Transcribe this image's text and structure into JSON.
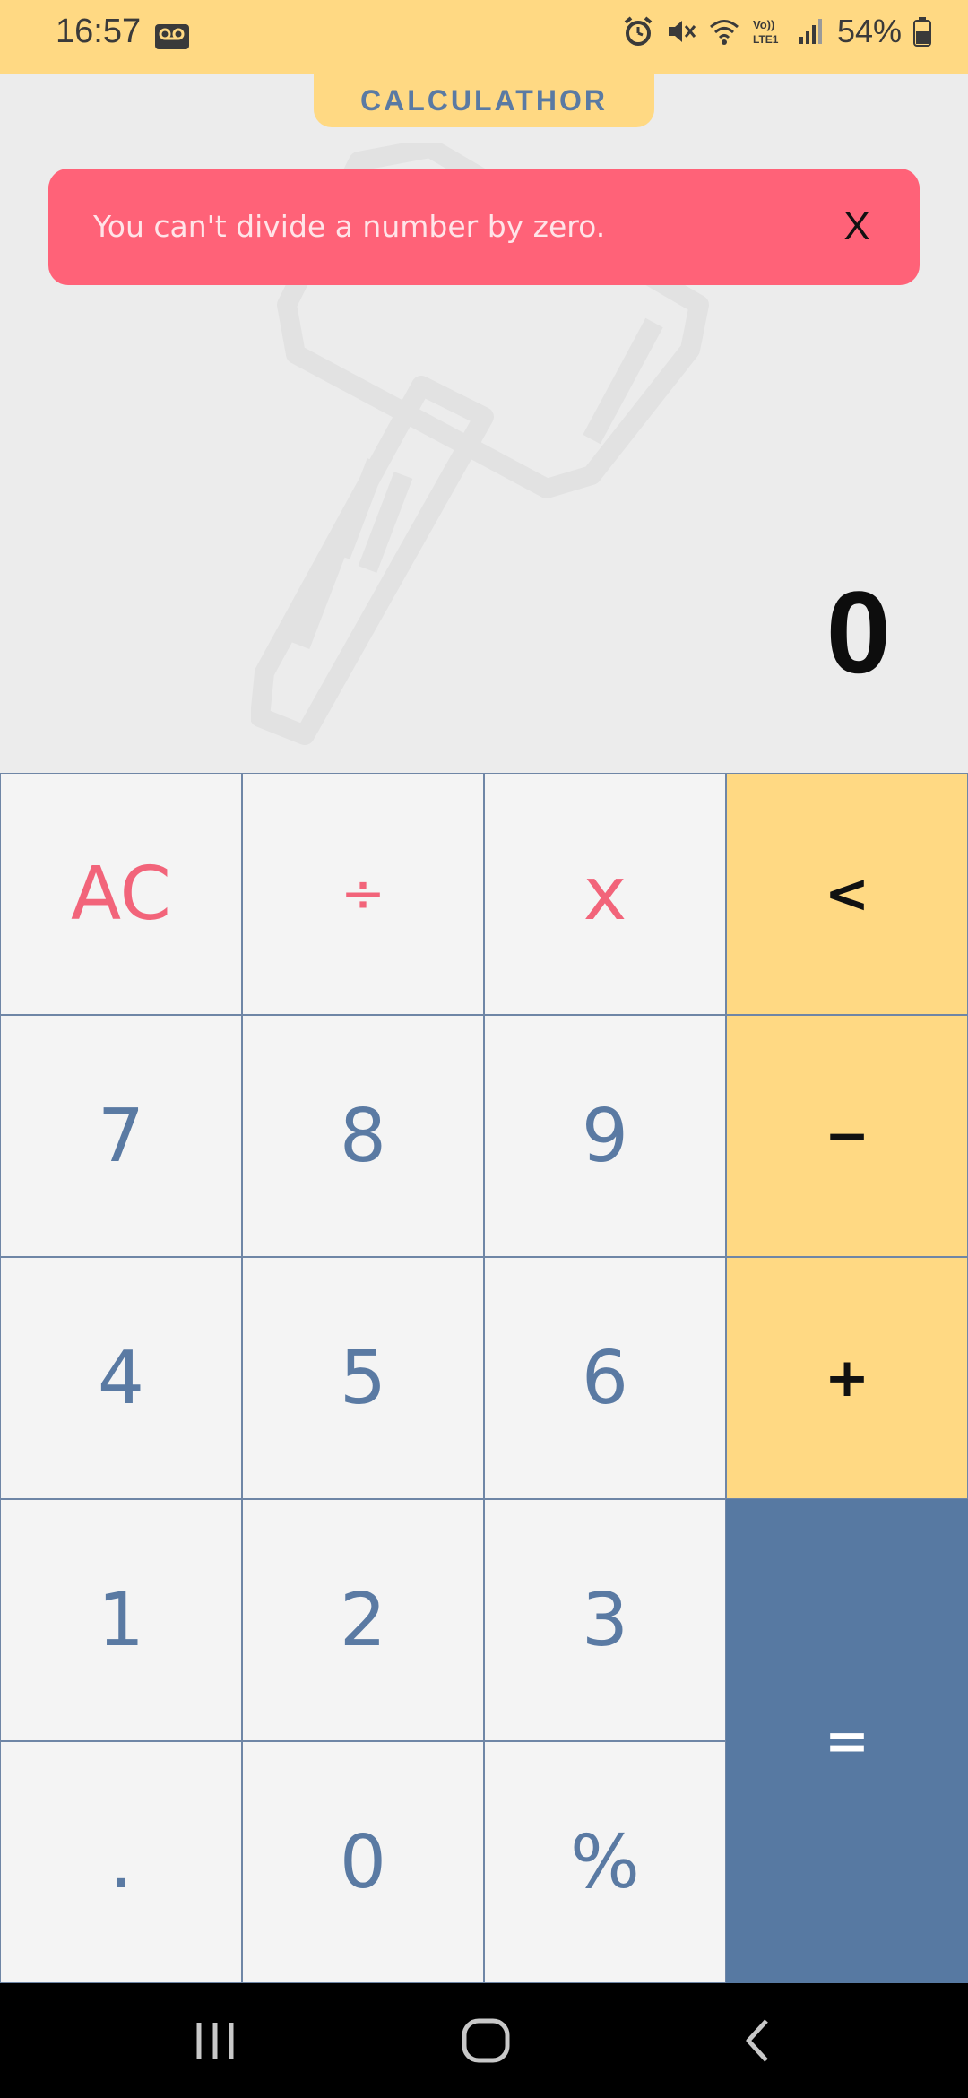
{
  "status_bar": {
    "time": "16:57",
    "battery": "54%",
    "icons": [
      "voicemail-icon",
      "alarm-icon",
      "mute-icon",
      "wifi-icon",
      "volte-icon",
      "signal-icon",
      "battery-icon"
    ]
  },
  "app": {
    "title": "CALCULATHOR"
  },
  "alert": {
    "message": "You can't divide a number by zero.",
    "close_label": "X"
  },
  "display": {
    "value": "0"
  },
  "keys": {
    "ac": "AC",
    "divide": "÷",
    "multiply": "x",
    "backspace": "<",
    "seven": "7",
    "eight": "8",
    "nine": "9",
    "minus": "−",
    "four": "4",
    "five": "5",
    "six": "6",
    "plus": "+",
    "one": "1",
    "two": "2",
    "three": "3",
    "equals": "=",
    "dot": ".",
    "zero": "0",
    "percent": "%"
  },
  "colors": {
    "accent_yellow": "#ffd983",
    "accent_blue": "#5779a2",
    "alert_red": "#ff6278",
    "digit_blue": "#5a7aa3",
    "operator_red": "#f2647a"
  }
}
